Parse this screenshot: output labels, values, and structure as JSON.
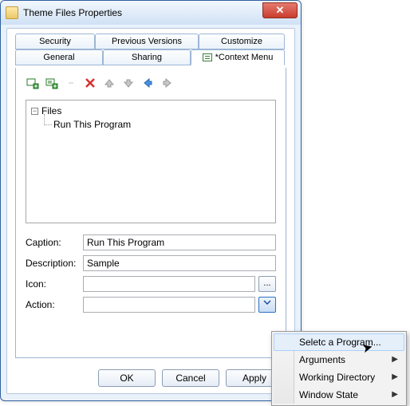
{
  "window": {
    "title": "Theme Files Properties"
  },
  "tabs": {
    "row1": [
      "Security",
      "Previous Versions",
      "Customize"
    ],
    "row2": [
      "General",
      "Sharing",
      "*Context Menu"
    ],
    "active": "*Context Menu"
  },
  "toolbar_icons": {
    "add1": "add-scope-icon",
    "add2": "add-item-icon",
    "remove": "delete-icon",
    "up": "move-up-icon",
    "down": "move-down-icon",
    "left": "back-icon",
    "right": "forward-icon"
  },
  "tree": {
    "root": "Files",
    "children": [
      "Run This Program"
    ]
  },
  "form": {
    "caption_label": "Caption:",
    "caption_value": "Run This Program",
    "description_label": "Description:",
    "description_value": "Sample",
    "icon_label": "Icon:",
    "icon_value": "",
    "browse_label": "...",
    "action_label": "Action:",
    "action_value": ""
  },
  "buttons": {
    "ok": "OK",
    "cancel": "Cancel",
    "apply": "Apply"
  },
  "popup": {
    "items": [
      {
        "label": "Seletc a Program...",
        "submenu": false
      },
      {
        "label": "Arguments",
        "submenu": true
      },
      {
        "label": "Working Directory",
        "submenu": true
      },
      {
        "label": "Window State",
        "submenu": true
      }
    ],
    "hover_index": 0
  }
}
